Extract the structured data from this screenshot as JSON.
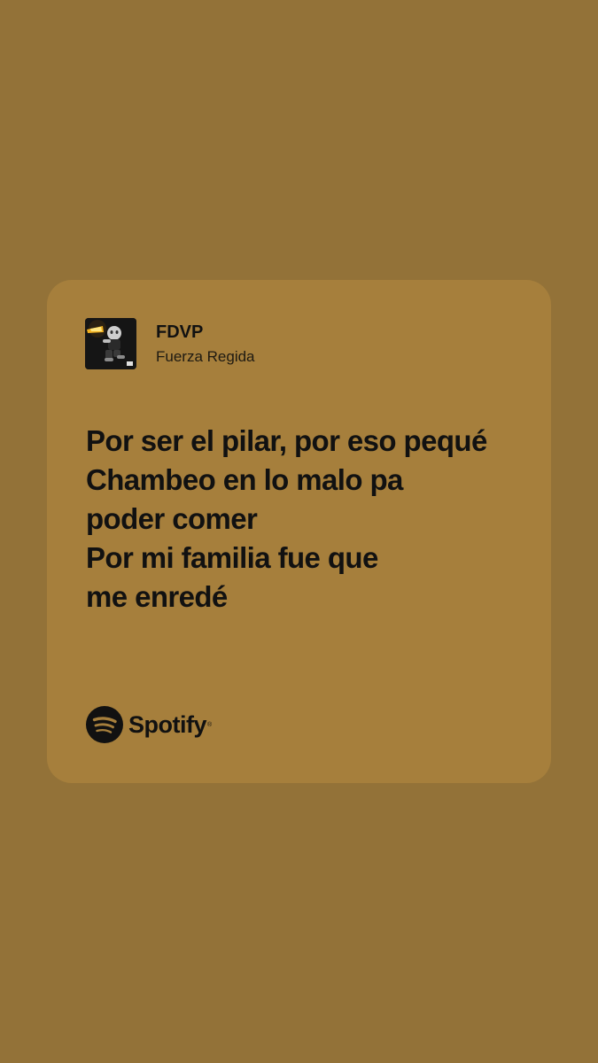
{
  "track": {
    "title": "FDVP",
    "artist": "Fuerza Regida",
    "cover_icon": "album-cover-image"
  },
  "lyrics": {
    "lines": [
      "Por ser el pilar, por eso pequé",
      "Chambeo en lo malo pa",
      "poder comer",
      "Por mi familia fue que",
      "me enredé"
    ]
  },
  "brand": {
    "name": "Spotify",
    "icon": "spotify-logo-icon"
  },
  "colors": {
    "background": "#937238",
    "card": "#a67f3c",
    "text": "#111111"
  }
}
